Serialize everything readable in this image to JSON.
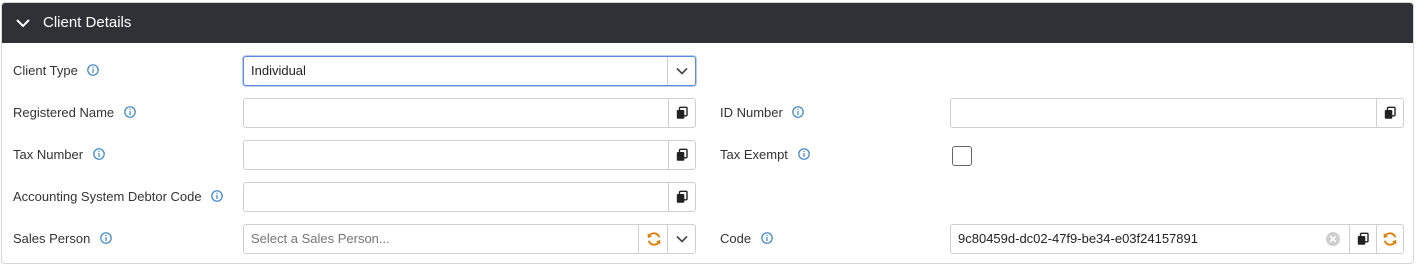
{
  "panel": {
    "title": "Client Details",
    "collapse_icon": "chevron-down-icon"
  },
  "fields": {
    "client_type": {
      "label": "Client Type",
      "value": "Individual"
    },
    "registered_name": {
      "label": "Registered Name",
      "value": ""
    },
    "id_number": {
      "label": "ID Number",
      "value": ""
    },
    "tax_number": {
      "label": "Tax Number",
      "value": ""
    },
    "tax_exempt": {
      "label": "Tax Exempt",
      "checked": false
    },
    "accounting_code": {
      "label": "Accounting System Debtor Code",
      "value": ""
    },
    "sales_person": {
      "label": "Sales Person",
      "placeholder": "Select a Sales Person..."
    },
    "code": {
      "label": "Code",
      "value": "9c80459d-dc02-47f9-be34-e03f24157891"
    }
  },
  "icons": {
    "info": "info-icon",
    "copy": "copy-icon",
    "refresh": "refresh-icon",
    "dropdown": "chevron-down-icon",
    "clear": "clear-icon"
  },
  "colors": {
    "header_bg": "#2f3136",
    "info_icon": "#3b82c4",
    "refresh_icon": "#e07b00",
    "focus_border": "#5b8bd9"
  }
}
